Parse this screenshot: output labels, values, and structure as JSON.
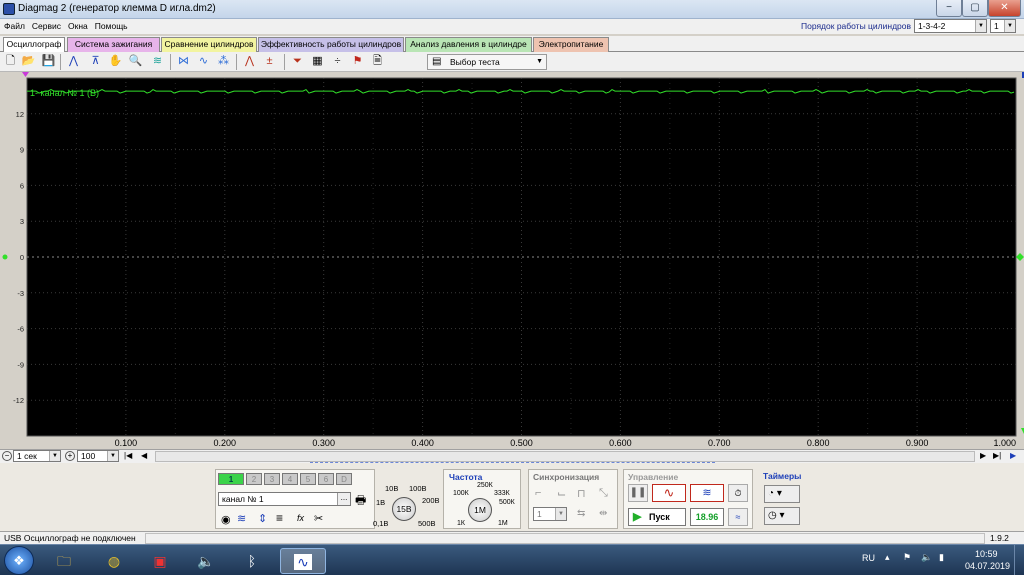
{
  "window": {
    "title": "Diagmag 2 (генератор клемма D игла.dm2)",
    "min": "−",
    "max": "▢",
    "close": "✕"
  },
  "menu": [
    "Файл",
    "Сервис",
    "Окна",
    "Помощь"
  ],
  "cylinders": {
    "label": "Порядок работы цилиндров",
    "order_value": "1-3-4-2",
    "num_value": "1"
  },
  "tabs": [
    {
      "label": "Осциллограф",
      "color": "#ffffff"
    },
    {
      "label": "Система зажигания",
      "color": "#e7b4ea"
    },
    {
      "label": "Сравнение цилиндров",
      "color": "#f2f4a0"
    },
    {
      "label": "Эффективность работы цилиндров",
      "color": "#c6c0e8"
    },
    {
      "label": "Анализ давления в цилиндре",
      "color": "#b9e5b5"
    },
    {
      "label": "Электропитание",
      "color": "#eec3b0"
    }
  ],
  "toolbar": {
    "test_select": "Выбор теста"
  },
  "scope": {
    "channel_label": "1- канал № 1 (В)",
    "y_ticks": [
      "12",
      "9",
      "6",
      "3",
      "0",
      "-3",
      "-6",
      "-9",
      "-12"
    ],
    "x_ticks": [
      "0.100",
      "0.200",
      "0.300",
      "0.400",
      "0.500",
      "0.600",
      "0.700",
      "0.800",
      "0.900",
      "1.000"
    ],
    "trace_color": "#32e02a",
    "trace_level_v": 13.9,
    "y_range": [
      -15,
      15
    ],
    "x_range": [
      0,
      1
    ]
  },
  "timebase": {
    "value": "1 сек",
    "zoom": "100"
  },
  "channels": {
    "tabs": [
      "1",
      "2",
      "3",
      "4",
      "5",
      "6",
      "D"
    ],
    "name_value": "канал № 1",
    "name_btn": "..."
  },
  "voltage": {
    "current": "15В",
    "labels": [
      "10В",
      "100В",
      "1В",
      "200В",
      "0,1В",
      "500В"
    ]
  },
  "freq": {
    "title": "Частота",
    "current": "1М",
    "labels": [
      "250К",
      "100К",
      "333К",
      "500К",
      "1К",
      "1М"
    ]
  },
  "sync": {
    "title": "Синхронизация",
    "value": "1"
  },
  "control": {
    "title": "Управление",
    "start": "Пуск",
    "readout": "18.96"
  },
  "timers": {
    "title": "Таймеры"
  },
  "status": {
    "left": "USB Осциллограф не подключен",
    "right": "1.9.2"
  },
  "taskbar": {
    "lang": "RU",
    "time": "10:59",
    "date": "04.07.2019"
  }
}
